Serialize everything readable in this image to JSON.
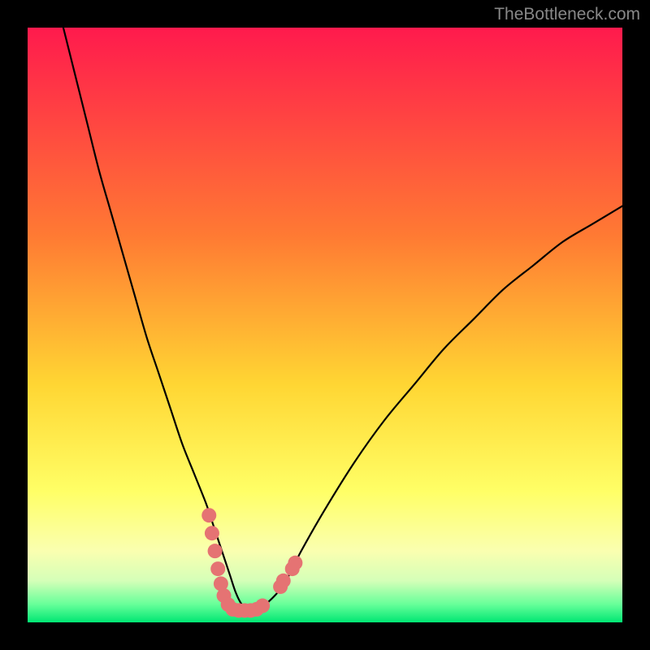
{
  "watermark": "TheBottleneck.com",
  "chart_data": {
    "type": "line",
    "title": "",
    "xlabel": "",
    "ylabel": "",
    "xlim": [
      0,
      100
    ],
    "ylim": [
      0,
      100
    ],
    "background": {
      "gradient_stops": [
        {
          "offset": 0,
          "color": "#ff1a4d"
        },
        {
          "offset": 0.35,
          "color": "#ff7a33"
        },
        {
          "offset": 0.6,
          "color": "#ffd633"
        },
        {
          "offset": 0.78,
          "color": "#ffff66"
        },
        {
          "offset": 0.88,
          "color": "#faffb0"
        },
        {
          "offset": 0.93,
          "color": "#d5ffb8"
        },
        {
          "offset": 0.97,
          "color": "#66ff99"
        },
        {
          "offset": 1.0,
          "color": "#00e673"
        }
      ]
    },
    "series": [
      {
        "name": "bottleneck-curve",
        "color": "#000000",
        "x": [
          6,
          8,
          10,
          12,
          14,
          16,
          18,
          20,
          22,
          24,
          26,
          28,
          30,
          31,
          32,
          33,
          34,
          35,
          36,
          37,
          38,
          39,
          40,
          42,
          44,
          46,
          50,
          55,
          60,
          65,
          70,
          75,
          80,
          85,
          90,
          95,
          100
        ],
        "y": [
          100,
          92,
          84,
          76,
          69,
          62,
          55,
          48,
          42,
          36,
          30,
          25,
          20,
          17,
          14,
          11,
          8,
          5,
          3,
          2,
          2,
          2,
          3,
          5,
          8,
          12,
          19,
          27,
          34,
          40,
          46,
          51,
          56,
          60,
          64,
          67,
          70
        ]
      }
    ],
    "markers": {
      "name": "highlight-dots",
      "color": "#e57373",
      "radius_px": 9,
      "points": [
        {
          "x": 30.5,
          "y": 18
        },
        {
          "x": 31,
          "y": 15
        },
        {
          "x": 31.5,
          "y": 12
        },
        {
          "x": 32,
          "y": 9
        },
        {
          "x": 32.5,
          "y": 6.5
        },
        {
          "x": 33,
          "y": 4.5
        },
        {
          "x": 33.7,
          "y": 3
        },
        {
          "x": 34.5,
          "y": 2.2
        },
        {
          "x": 35.5,
          "y": 2
        },
        {
          "x": 36.5,
          "y": 2
        },
        {
          "x": 37.5,
          "y": 2
        },
        {
          "x": 38.5,
          "y": 2.2
        },
        {
          "x": 39.5,
          "y": 2.8
        },
        {
          "x": 42.5,
          "y": 6
        },
        {
          "x": 43,
          "y": 7
        },
        {
          "x": 44.5,
          "y": 9
        },
        {
          "x": 45,
          "y": 10
        }
      ]
    }
  }
}
